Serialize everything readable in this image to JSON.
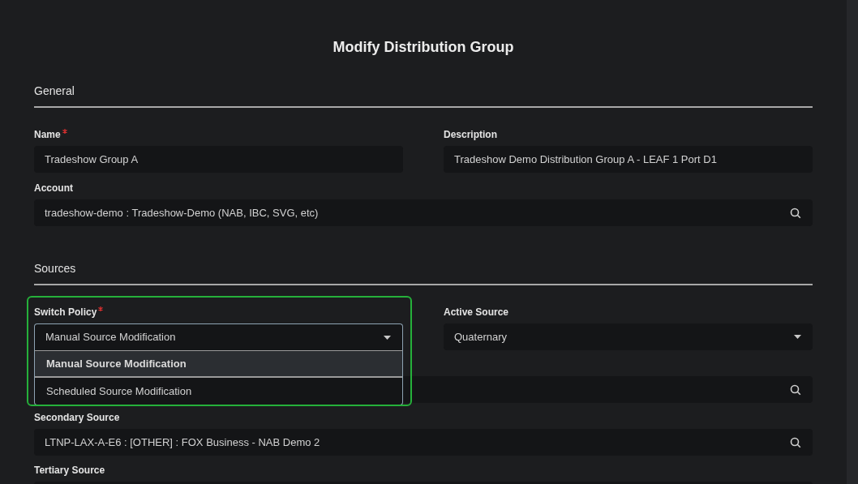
{
  "dialog": {
    "title": "Modify Distribution Group"
  },
  "sections": [
    {
      "heading": "General",
      "rows": [
        [
          {
            "label": "Name",
            "required": true,
            "kind": "text",
            "value": "Tradeshow Group A"
          },
          {
            "label": "Description",
            "required": false,
            "kind": "text",
            "value": "Tradeshow Demo Distribution Group A - LEAF 1 Port D1"
          }
        ],
        [
          {
            "label": "Account",
            "required": false,
            "kind": "lookup",
            "value": "tradeshow-demo : Tradeshow-Demo (NAB, IBC, SVG, etc)"
          }
        ]
      ]
    },
    {
      "heading": "Sources",
      "rows": [
        [
          {
            "label": "Switch Policy",
            "required": true,
            "kind": "select",
            "value": "Manual Source Modification",
            "expanded": true,
            "options": [
              {
                "label": "Manual Source Modification",
                "selected": true
              },
              {
                "label": "Scheduled Source Modification",
                "selected": false
              }
            ]
          },
          {
            "label": "Active Source",
            "required": false,
            "kind": "select",
            "value": "Quaternary",
            "expanded": false
          }
        ],
        [
          {
            "kind": "lookup"
          }
        ],
        [
          {
            "label": "Secondary Source",
            "required": false,
            "kind": "lookup",
            "value": "LTNP-LAX-A-E6 : [OTHER] : FOX Business - NAB Demo 2"
          }
        ],
        [
          {
            "label": "Tertiary Source",
            "required": false,
            "kind": "text"
          }
        ]
      ]
    }
  ]
}
